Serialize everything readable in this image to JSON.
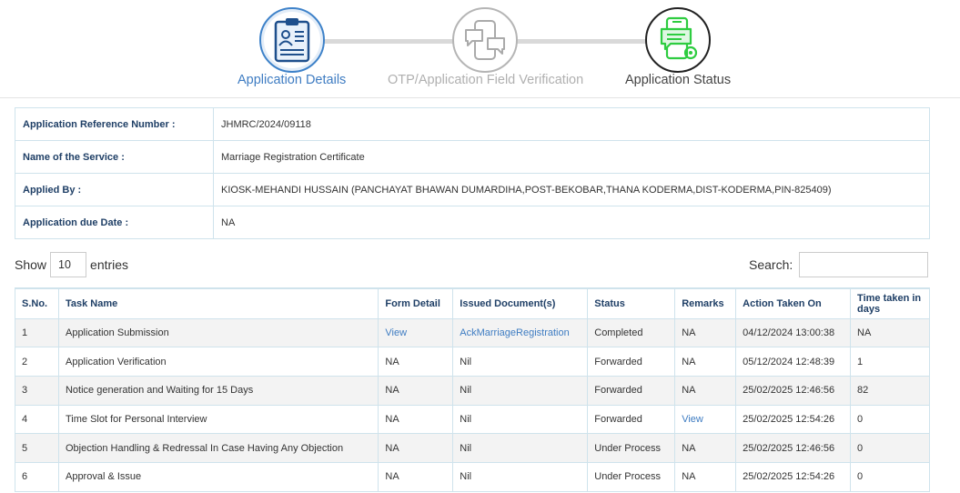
{
  "steps": [
    {
      "label": "Application Details",
      "icon": "application-form-icon",
      "state": "active"
    },
    {
      "label": "OTP/Application Field Verification",
      "icon": "chat-verification-icon",
      "state": "pending"
    },
    {
      "label": "Application Status",
      "icon": "status-document-icon",
      "state": "current"
    }
  ],
  "info": {
    "ref_label": "Application Reference Number :",
    "ref_value": "JHMRC/2024/09118",
    "service_label": "Name of the Service :",
    "service_value": "Marriage Registration Certificate",
    "applied_label": "Applied By :",
    "applied_value": "KIOSK-MEHANDI HUSSAIN (PANCHAYAT BHAWAN DUMARDIHA,POST-BEKOBAR,THANA KODERMA,DIST-KODERMA,PIN-825409)",
    "due_label": "Application due Date :",
    "due_value": "NA"
  },
  "controls": {
    "show_label": "Show",
    "entries_value": "10",
    "entries_label": "entries",
    "search_label": "Search:"
  },
  "table": {
    "headers": [
      "S.No.",
      "Task Name",
      "Form Detail",
      "Issued Document(s)",
      "Status",
      "Remarks",
      "Action Taken On",
      "Time taken in days"
    ],
    "rows": [
      [
        "1",
        "Application Submission",
        "View",
        "AckMarriageRegistration",
        "Completed",
        "NA",
        "04/12/2024 13:00:38",
        "NA"
      ],
      [
        "2",
        "Application Verification",
        "NA",
        "Nil",
        "Forwarded",
        "NA",
        "05/12/2024 12:48:39",
        "1"
      ],
      [
        "3",
        "Notice generation and Waiting for 15 Days",
        "NA",
        "Nil",
        "Forwarded",
        "NA",
        "25/02/2025 12:46:56",
        "82"
      ],
      [
        "4",
        "Time Slot for Personal Interview",
        "NA",
        "Nil",
        "Forwarded",
        "View",
        "25/02/2025 12:54:26",
        "0"
      ],
      [
        "5",
        "Objection Handling & Redressal In Case Having Any Objection",
        "NA",
        "Nil",
        "Under Process",
        "NA",
        "25/02/2025 12:46:56",
        "0"
      ],
      [
        "6",
        "Approval & Issue",
        "NA",
        "Nil",
        "Under Process",
        "NA",
        "25/02/2025 12:54:26",
        "0"
      ]
    ]
  },
  "colors": {
    "accent": "#3e7cc2",
    "header_text": "#1f3f66",
    "border": "#cfe3ec",
    "status_green": "#2ecc40"
  }
}
